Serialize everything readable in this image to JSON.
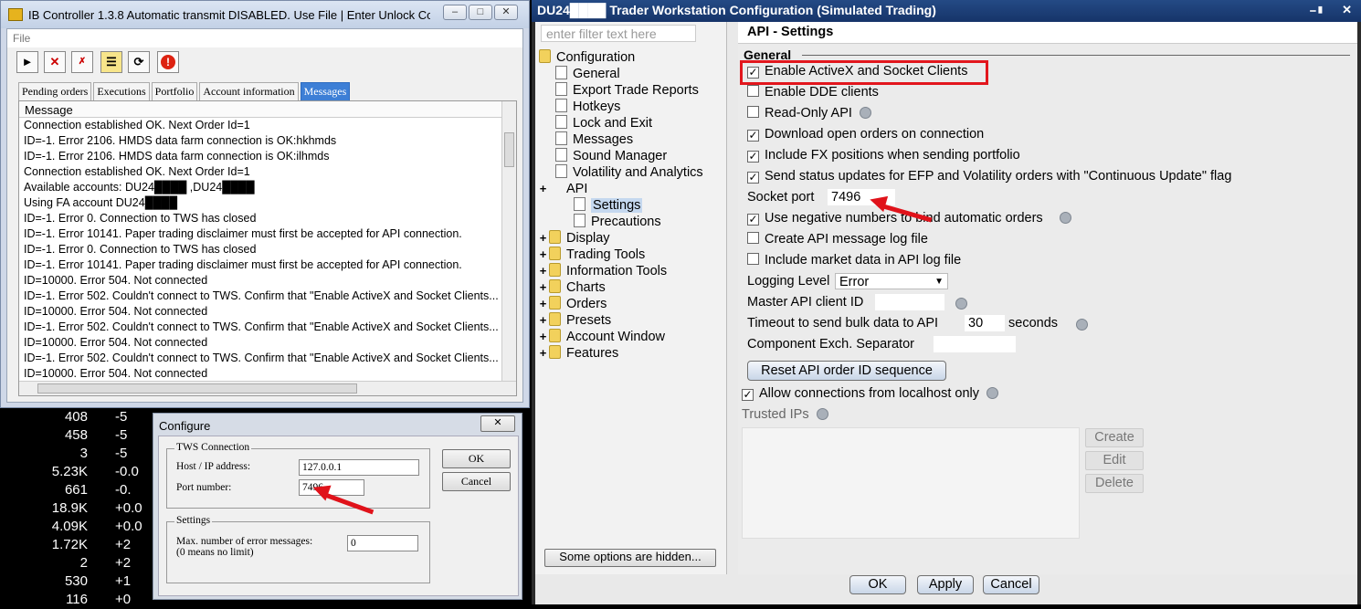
{
  "ibc": {
    "title": "IB Controller 1.3.8 Automatic transmit DISABLED. Use File | Enter Unlock Co...",
    "menu_file": "File",
    "tabs": [
      "Pending orders",
      "Executions",
      "Portfolio",
      "Account information",
      "Messages"
    ],
    "messages_header": "Message",
    "messages": [
      "Connection established OK. Next Order Id=1",
      "ID=-1. Error 2106. HMDS data farm connection is OK:hkhmds",
      "ID=-1. Error 2106. HMDS data farm connection is OK:ilhmds",
      "Connection established OK. Next Order Id=1",
      "Available accounts: DU24████ ,DU24████",
      "Using FA account DU24████",
      "ID=-1. Error 0. Connection to TWS has closed",
      "ID=-1. Error 10141. Paper trading disclaimer must first be accepted for API connection.",
      "ID=-1. Error 0. Connection to TWS has closed",
      "ID=-1. Error 10141. Paper trading disclaimer must first be accepted for API connection.",
      "ID=10000. Error 504. Not connected",
      "ID=-1. Error 502. Couldn't connect to TWS.  Confirm that \"Enable ActiveX and Socket Clients...",
      "ID=10000. Error 504. Not connected",
      "ID=-1. Error 502. Couldn't connect to TWS.  Confirm that \"Enable ActiveX and Socket Clients...",
      "ID=10000. Error 504. Not connected",
      "ID=-1. Error 502. Couldn't connect to TWS.  Confirm that \"Enable ActiveX and Socket Clients...",
      "ID=10000. Error 504. Not connected"
    ]
  },
  "ticker": {
    "values": [
      "408",
      "458",
      "3",
      "5.23K",
      "661",
      "18.9K",
      "4.09K",
      "1.72K",
      "2",
      "530",
      "116"
    ],
    "changes": [
      "-5",
      "-5",
      "-5",
      "-0.0",
      "-0.",
      "+0.0",
      "+0.0",
      "+2",
      "+2",
      "+1",
      "+0"
    ]
  },
  "configure": {
    "title": "Configure",
    "close": "✕",
    "tws_group": "TWS Connection",
    "host_label": "Host / IP address:",
    "host_value": "127.0.0.1",
    "port_label": "Port number:",
    "port_value": "7496",
    "settings_group": "Settings",
    "max_errors_label": "Max. number of error messages:",
    "max_errors_note": "(0 means no limit)",
    "max_errors_value": "0",
    "ok": "OK",
    "cancel": "Cancel"
  },
  "tws": {
    "title": "DU24████  Trader Workstation Configuration (Simulated Trading)",
    "filter_placeholder": "enter filter text here",
    "tree": {
      "root": "Configuration",
      "items": [
        "General",
        "Export Trade Reports",
        "Hotkeys",
        "Lock and Exit",
        "Messages",
        "Sound Manager",
        "Volatility and Analytics"
      ],
      "api": "API",
      "api_children": [
        "Settings",
        "Precautions"
      ],
      "groups": [
        "Display",
        "Trading Tools",
        "Information Tools",
        "Charts",
        "Orders",
        "Presets",
        "Account Window",
        "Features"
      ]
    },
    "hidden_options": "Some options are hidden...",
    "page_title": "API - Settings",
    "section": "General",
    "options": [
      {
        "label": "Enable ActiveX and Socket Clients",
        "checked": true
      },
      {
        "label": "Enable DDE clients",
        "checked": false
      },
      {
        "label": "Read-Only API",
        "checked": false
      },
      {
        "label": "Download open orders on connection",
        "checked": true
      },
      {
        "label": "Include FX positions when sending portfolio",
        "checked": true
      },
      {
        "label": "Send status updates for EFP and Volatility orders with \"Continuous Update\" flag",
        "checked": true
      }
    ],
    "socket_port_label": "Socket port",
    "socket_port_value": "7496",
    "options2": [
      {
        "label": "Use negative numbers to bind automatic orders",
        "checked": true
      },
      {
        "label": "Create API message log file",
        "checked": false
      },
      {
        "label": "Include market data in API log file",
        "checked": false
      }
    ],
    "logging_label": "Logging Level",
    "logging_value": "Error",
    "master_label": "Master API client ID",
    "master_value": "",
    "timeout_label": "Timeout to send bulk data to API",
    "timeout_value": "30",
    "timeout_unit": "seconds",
    "separator_label": "Component Exch. Separator",
    "separator_value": "",
    "reset_button": "Reset API order ID sequence",
    "localhost_label": "Allow connections from localhost only",
    "localhost_checked": true,
    "trusted_label": "Trusted IPs",
    "create": "Create",
    "edit": "Edit",
    "delete": "Delete",
    "ok": "OK",
    "apply": "Apply",
    "cancel": "Cancel"
  },
  "colors": {
    "highlight_red": "#e2161d",
    "title_blue": "#1b3d78",
    "tab_active": "#3d7fd6"
  }
}
